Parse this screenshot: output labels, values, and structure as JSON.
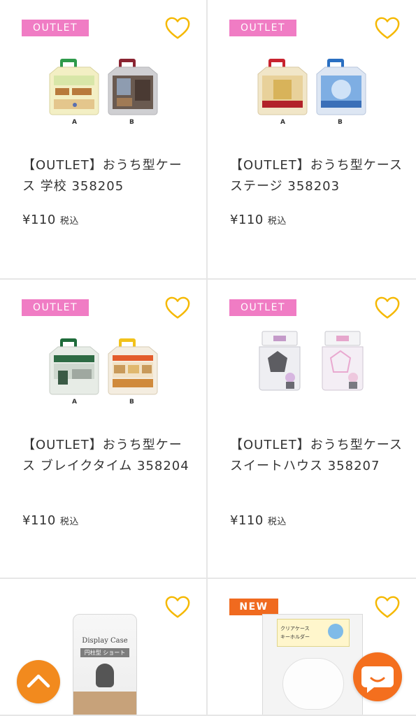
{
  "colors": {
    "outlet_badge": "#f07cc4",
    "new_badge": "#f06a1f",
    "heart_outline": "#f5b800",
    "accent_orange": "#f28a1e"
  },
  "products": [
    {
      "badge": "OUTLET",
      "title": "【OUTLET】おうち型ケース 学校 358205",
      "price": "¥110",
      "tax": "税込",
      "variant_a": "A",
      "variant_b": "B",
      "icon": "heart-icon"
    },
    {
      "badge": "OUTLET",
      "title": "【OUTLET】おうち型ケース ステージ 358203",
      "price": "¥110",
      "tax": "税込",
      "variant_a": "A",
      "variant_b": "B",
      "icon": "heart-icon"
    },
    {
      "badge": "OUTLET",
      "title": "【OUTLET】おうち型ケース ブレイクタイム 358204",
      "price": "¥110",
      "tax": "税込",
      "variant_a": "A",
      "variant_b": "B",
      "icon": "heart-icon"
    },
    {
      "badge": "OUTLET",
      "title": "【OUTLET】おうち型ケース スイートハウス 358207",
      "price": "¥110",
      "tax": "税込",
      "icon": "heart-icon"
    },
    {
      "package_text_1": "Display Case",
      "package_text_2": "円柱型 ショート",
      "icon": "heart-icon"
    },
    {
      "badge": "NEW",
      "package_text_1": "クリアケース",
      "package_text_2": "キーホルダー",
      "icon": "heart-icon"
    }
  ],
  "floating": {
    "scroll_top_icon": "chevron-up-icon",
    "chat_icon": "chat-bubble-icon"
  }
}
